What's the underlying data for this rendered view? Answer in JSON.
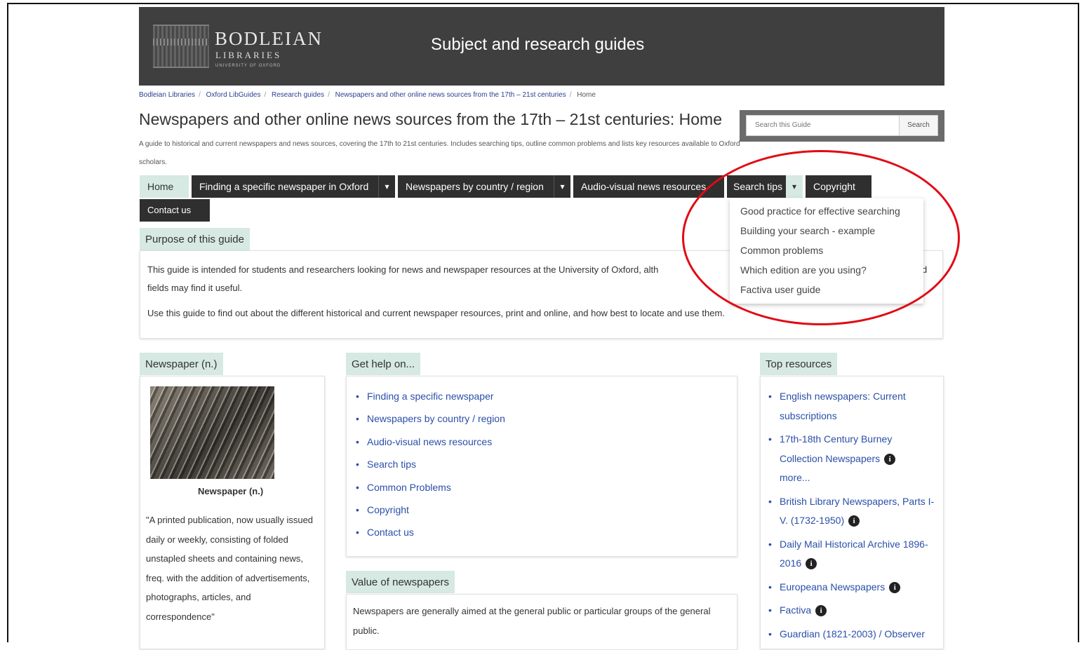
{
  "header": {
    "logo_main": "BODLEIAN",
    "logo_sub": "LIBRARIES",
    "logo_tiny": "UNIVERSITY OF OXFORD",
    "site_title": "Subject and research guides"
  },
  "breadcrumb": [
    "Bodleian Libraries",
    "Oxford LibGuides",
    "Research guides",
    "Newspapers and other online news sources from the 17th – 21st centuries",
    "Home"
  ],
  "page": {
    "title": "Newspapers and other online news sources from the 17th – 21st centuries: Home",
    "description": "A guide to historical and current newspapers and news sources, covering the 17th to 21st centuries. Includes searching tips, outline common problems and lists key resources available to Oxford scholars."
  },
  "search": {
    "placeholder": "Search this Guide",
    "button": "Search"
  },
  "tabs": [
    {
      "label": "Home"
    },
    {
      "label": "Finding a specific newspaper in Oxford"
    },
    {
      "label": "Newspapers by country / region"
    },
    {
      "label": "Audio-visual news resources"
    },
    {
      "label": "Search tips"
    },
    {
      "label": "Copyright"
    },
    {
      "label": "Contact us"
    }
  ],
  "dropdown_caret": "▾",
  "search_tips_menu": [
    "Good practice for effective searching",
    "Building your search - example",
    "Common problems",
    "Which edition are you using?",
    "Factiva user guide"
  ],
  "purpose": {
    "heading": "Purpose of this guide",
    "line1": "This guide is intended for students and researchers looking for news and newspaper resources at the University of Oxford, alth",
    "line1_tail": "d",
    "line2": "fields may find it useful.",
    "line3": "Use this guide to find out about the different historical and current newspaper resources, print and online, and how best to locate and use them."
  },
  "newspaper_box": {
    "heading": "Newspaper (n.)",
    "caption": "Newspaper (n.)",
    "quote": "\"A printed publication, now usually issued daily or weekly, consisting of folded unstapled sheets and containing news, freq. with the addition of advertisements, photographs, articles, and correspondence\""
  },
  "help_box": {
    "heading": "Get help on...",
    "items": [
      "Finding a specific newspaper",
      "Newspapers by country / region",
      "Audio-visual news resources",
      "Search tips",
      "Common Problems",
      "Copyright",
      "Contact us"
    ]
  },
  "value_box": {
    "heading": "Value of newspapers",
    "text": "Newspapers are generally aimed at the general public or particular groups of the general public."
  },
  "top_resources": {
    "heading": "Top resources",
    "info_glyph": "i",
    "items": [
      {
        "label": "English newspapers: Current subscriptions"
      },
      {
        "label": "17th-18th Century Burney Collection Newspapers",
        "more": "more..."
      },
      {
        "label": "British Library Newspapers, Parts I-V. (1732-1950)"
      },
      {
        "label": "Daily Mail Historical Archive 1896-2016"
      },
      {
        "label": "Europeana Newspapers"
      },
      {
        "label": "Factiva"
      },
      {
        "label": "Guardian (1821-2003) / Observer"
      }
    ]
  },
  "colors": {
    "banner": "#3f3f3f",
    "tab_dark": "#2f2f2f",
    "tab_active": "#d6e9e3",
    "link": "#2a4fa8",
    "annotation": "#e10a14"
  }
}
